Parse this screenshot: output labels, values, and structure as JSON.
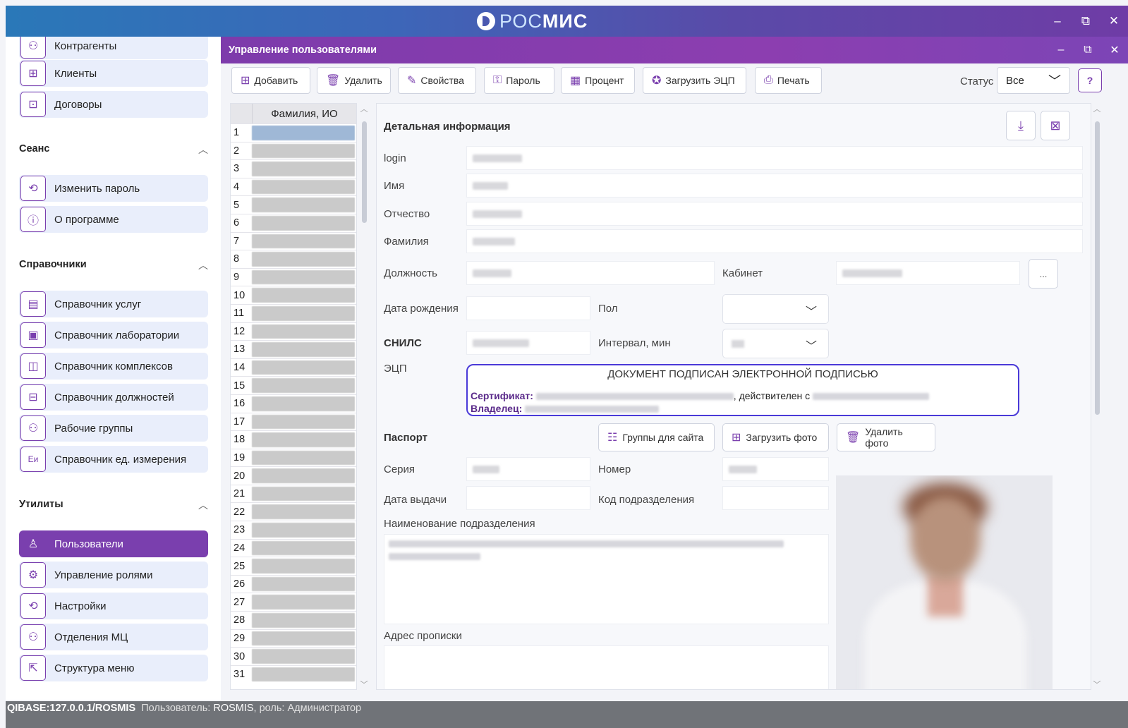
{
  "app": {
    "brand_prefix": "РОС",
    "brand_suffix": "МИС",
    "win_minimize": "–",
    "win_restore": "⧉",
    "win_close": "✕"
  },
  "sidebar": {
    "top_items": [
      {
        "label": "Контрагенты",
        "icon": "contractors-icon"
      },
      {
        "label": "Клиенты",
        "icon": "clients-icon"
      },
      {
        "label": "Договоры",
        "icon": "contracts-icon"
      }
    ],
    "sections": [
      {
        "title": "Сеанс",
        "items": [
          {
            "label": "Изменить пароль",
            "icon": "change-password-icon"
          },
          {
            "label": "О программе",
            "icon": "about-icon"
          }
        ]
      },
      {
        "title": "Справочники",
        "items": [
          {
            "label": "Справочник услуг",
            "icon": "services-icon"
          },
          {
            "label": "Справочник лаборатории",
            "icon": "laboratory-icon"
          },
          {
            "label": "Справочник комплексов",
            "icon": "complexes-icon"
          },
          {
            "label": "Справочник должностей",
            "icon": "positions-icon"
          },
          {
            "label": "Рабочие группы",
            "icon": "workgroups-icon"
          },
          {
            "label": "Справочник ед. измерения",
            "icon": "units-icon"
          }
        ]
      },
      {
        "title": "Утилиты",
        "items": [
          {
            "label": "Пользователи",
            "icon": "users-icon",
            "active": true
          },
          {
            "label": "Управление ролями",
            "icon": "roles-icon"
          },
          {
            "label": "Настройки",
            "icon": "settings-icon"
          },
          {
            "label": "Отделения МЦ",
            "icon": "departments-icon"
          },
          {
            "label": "Структура меню",
            "icon": "menu-structure-icon"
          }
        ]
      }
    ]
  },
  "panel": {
    "title": "Управление пользователями"
  },
  "toolbar": {
    "add": "Добавить",
    "delete": "Удалить",
    "properties": "Свойства",
    "password": "Пароль",
    "percent": "Процент",
    "load_ecp": "Загрузить ЭЦП",
    "print": "Печать",
    "status_label": "Статус",
    "status_value": "Все",
    "help": "?"
  },
  "list": {
    "header": "Фамилия, ИО",
    "rows": [
      "1",
      "2",
      "3",
      "4",
      "5",
      "6",
      "7",
      "8",
      "9",
      "10",
      "11",
      "12",
      "13",
      "14",
      "15",
      "16",
      "17",
      "18",
      "19",
      "20",
      "21",
      "22",
      "23",
      "24",
      "25",
      "26",
      "27",
      "28",
      "29",
      "30",
      "31"
    ]
  },
  "detail": {
    "title": "Детальная информация",
    "labels": {
      "login": "login",
      "name": "Имя",
      "patronymic": "Отчество",
      "surname": "Фамилия",
      "position": "Должность",
      "cabinet": "Кабинет",
      "birth_date": "Дата рождения",
      "gender": "Пол",
      "snils": "СНИЛС",
      "interval": "Интервал, мин",
      "ecp": "ЭЦП",
      "passport": "Паспорт",
      "series": "Серия",
      "number": "Номер",
      "issue_date": "Дата выдачи",
      "division_code": "Код подразделения",
      "division_name": "Наименование подразделения",
      "registration_address": "Адрес прописки"
    },
    "dots_button": "...",
    "signature": {
      "title": "ДОКУМЕНТ ПОДПИСАН ЭЛЕКТРОННОЙ ПОДПИСЬЮ",
      "cert_label": "Сертификат:",
      "valid_text": ", действителен с",
      "owner_label": "Владелец:"
    },
    "passport_buttons": {
      "site_groups": "Группы для сайта",
      "upload_photo": "Загрузить фото",
      "delete_photo": "Удалить фото"
    }
  },
  "statusbar": {
    "db": "QIBASE:127.0.0.1/ROSMIS",
    "user_label": "Пользователь:",
    "user": "ROSMIS",
    "role_label": ", роль:",
    "role": "Администратор"
  },
  "colors": {
    "accent": "#7a3fae",
    "active_item": "#7a3fae",
    "signature_border": "#4a3ad8"
  }
}
